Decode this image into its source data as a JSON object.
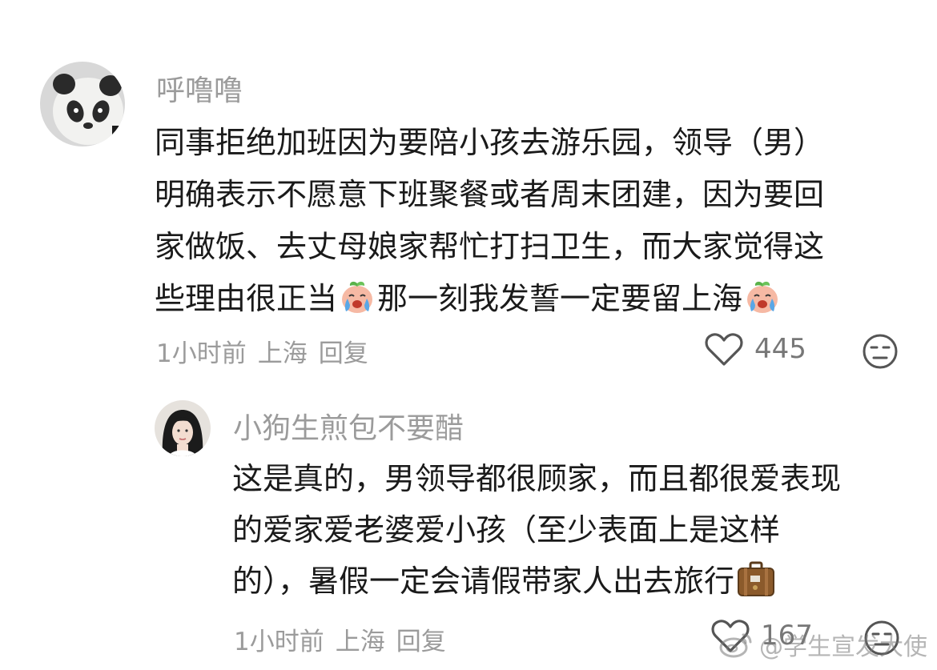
{
  "comments": [
    {
      "username": "呼噜噜",
      "lines": [
        "同事拒绝加班因为要陪小孩去游乐园，领导（男）",
        "明确表示不愿意下班聚餐或者周末团建，因为要回",
        "家做饭、去丈母娘家帮忙打扫卫生，而大家觉得这"
      ],
      "last_line_parts": [
        "些理由很正当",
        "那一刻我发誓一定要留上海"
      ],
      "time": "1小时前",
      "location": "上海",
      "reply_label": "回复",
      "like_count": "445"
    },
    {
      "username": "小狗生煎包不要醋",
      "lines": [
        "这是真的，男领导都很顾家，而且都很爱表现",
        "的爱家爱老婆爱小孩（至少表面上是这样"
      ],
      "last_line_parts": [
        "的），暑假一定会请假带家人出去旅行"
      ],
      "time": "1小时前",
      "location": "上海",
      "reply_label": "回复",
      "like_count": "167"
    }
  ],
  "watermark": "@学生宣发大使",
  "icons": {
    "like": "heart-outline-icon",
    "dislike": "meh-face-icon",
    "emoji_crying": "crying-peach-emoji",
    "emoji_luggage": "suitcase-emoji",
    "watermark_logo": "weibo-logo-icon"
  },
  "colors": {
    "text": "#1a1a1a",
    "muted": "#9b9b9b"
  }
}
